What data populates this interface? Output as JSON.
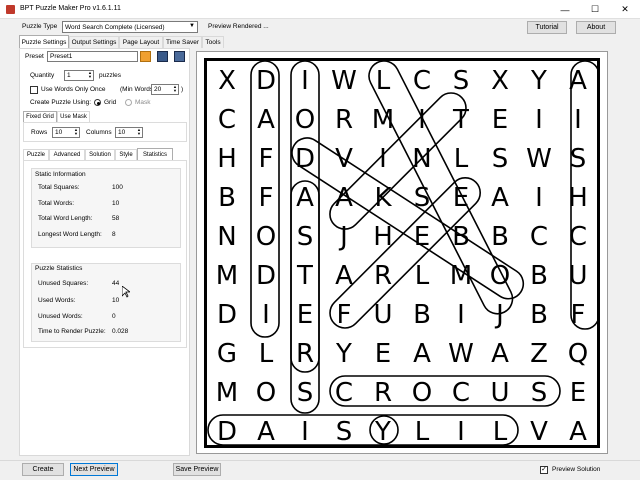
{
  "window": {
    "title": "BPT Puzzle Maker Pro v1.6.1.11",
    "minimize": "—",
    "maximize": "☐",
    "close": "✕"
  },
  "toolbar": {
    "puzzle_type_label": "Puzzle Type",
    "puzzle_type_value": "Word Search Complete (Licensed)",
    "status_text": "Preview Rendered ...",
    "tutorial_label": "Tutorial",
    "about_label": "About"
  },
  "tabs": [
    "Puzzle Settings",
    "Output Settings",
    "Page Layout",
    "Time Saver",
    "Tools"
  ],
  "settings": {
    "preset_label": "Preset",
    "preset_value": "Preset1",
    "quantity_label": "Quantity",
    "quantity_value": "1",
    "quantity_suffix": "puzzles",
    "use_words_once_label": "Use Words Only Once",
    "min_words_label": "(Min Words:",
    "min_words_value": "20",
    "min_words_close": ")",
    "create_using_label": "Create Puzzle Using:",
    "grid_option": "Grid",
    "mask_option": "Mask",
    "fixed_grid_tab": "Fixed Grid",
    "use_mask_tab": "Use Mask",
    "rows_label": "Rows",
    "rows_value": "10",
    "columns_label": "Columns",
    "columns_value": "10"
  },
  "subtabs": [
    "Puzzle",
    "Advanced",
    "Solution",
    "Style",
    "Statistics"
  ],
  "statistics": {
    "static_title": "Static Information",
    "static_items": [
      {
        "label": "Total Squares:",
        "value": "100"
      },
      {
        "label": "Total Words:",
        "value": "10"
      },
      {
        "label": "Total Word Length:",
        "value": "58"
      },
      {
        "label": "Longest Word Length:",
        "value": "8"
      }
    ],
    "puzzle_title": "Puzzle Statistics",
    "puzzle_items": [
      {
        "label": "Unused Squares:",
        "value": "44"
      },
      {
        "label": "Used Words:",
        "value": "10"
      },
      {
        "label": "Unused Words:",
        "value": "0"
      },
      {
        "label": "Time to Render Puzzle:",
        "value": "0.028"
      }
    ]
  },
  "grid": [
    [
      "X",
      "D",
      "I",
      "W",
      "L",
      "C",
      "S",
      "X",
      "Y",
      "A"
    ],
    [
      "C",
      "A",
      "O",
      "R",
      "M",
      "I",
      "T",
      "E",
      "I",
      "I"
    ],
    [
      "H",
      "F",
      "D",
      "V",
      "I",
      "N",
      "L",
      "S",
      "W",
      "S"
    ],
    [
      "B",
      "F",
      "A",
      "A",
      "K",
      "S",
      "E",
      "A",
      "I",
      "H"
    ],
    [
      "N",
      "O",
      "S",
      "J",
      "H",
      "E",
      "B",
      "B",
      "C",
      "C"
    ],
    [
      "M",
      "D",
      "T",
      "A",
      "R",
      "L",
      "M",
      "O",
      "B",
      "U"
    ],
    [
      "D",
      "I",
      "E",
      "F",
      "U",
      "B",
      "I",
      "J",
      "B",
      "F"
    ],
    [
      "G",
      "L",
      "R",
      "Y",
      "E",
      "A",
      "W",
      "A",
      "Z",
      "Q"
    ],
    [
      "M",
      "O",
      "S",
      "C",
      "R",
      "O",
      "C",
      "U",
      "S",
      "E"
    ],
    [
      "D",
      "A",
      "I",
      "S",
      "Y",
      "L",
      "I",
      "L",
      "V",
      "A"
    ]
  ],
  "bottom": {
    "create_label": "Create",
    "next_preview_label": "Next Preview",
    "save_preview_label": "Save Preview",
    "preview_solution_label": "Preview Solution"
  }
}
